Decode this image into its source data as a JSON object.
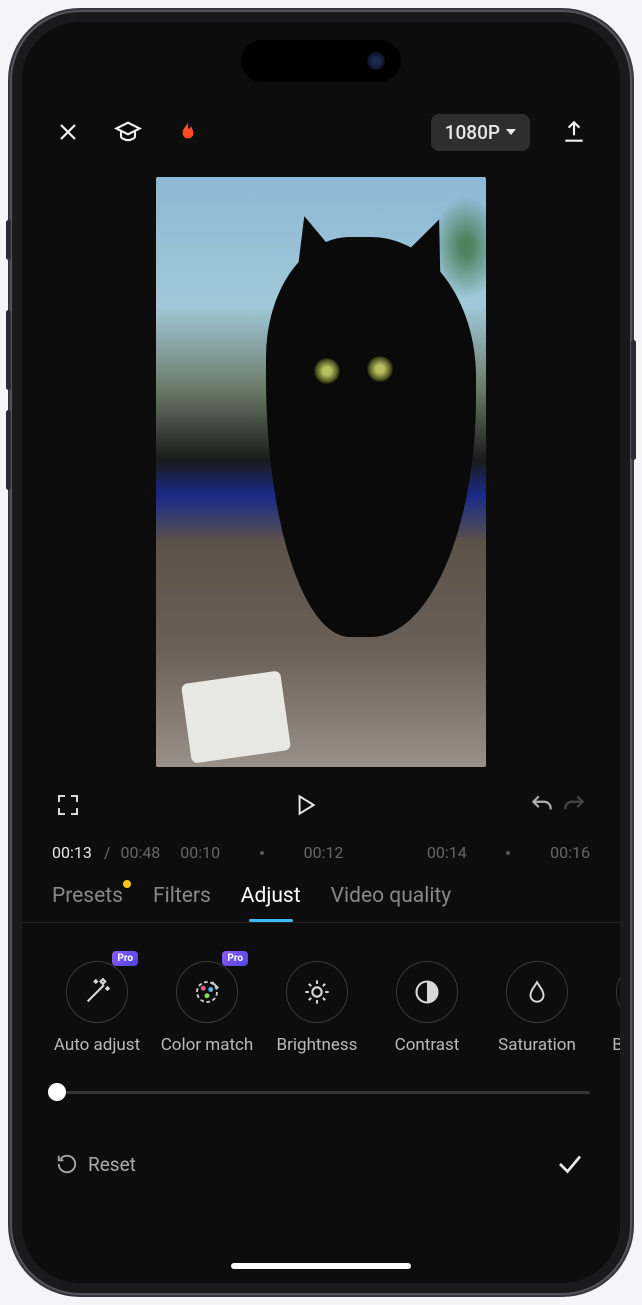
{
  "header": {
    "resolution_label": "1080P"
  },
  "playback": {
    "current_time": "00:13",
    "total_time": "00:48",
    "timeline_marks": [
      "00:10",
      "00:12",
      "00:14",
      "00:16"
    ]
  },
  "tabs": [
    {
      "label": "Presets",
      "active": false,
      "badge": true
    },
    {
      "label": "Filters",
      "active": false,
      "badge": false
    },
    {
      "label": "Adjust",
      "active": true,
      "badge": false
    },
    {
      "label": "Video quality",
      "active": false,
      "badge": false
    }
  ],
  "adjust_tools": [
    {
      "label": "Auto adjust",
      "icon": "wand-icon",
      "pro": true
    },
    {
      "label": "Color match",
      "icon": "palette-icon",
      "pro": true
    },
    {
      "label": "Brightness",
      "icon": "sun-icon",
      "pro": false
    },
    {
      "label": "Contrast",
      "icon": "contrast-icon",
      "pro": false
    },
    {
      "label": "Saturation",
      "icon": "droplet-icon",
      "pro": false
    },
    {
      "label": "Brilliance",
      "icon": "brilliance-icon",
      "pro": false
    }
  ],
  "pro_label": "Pro",
  "footer": {
    "reset_label": "Reset"
  }
}
